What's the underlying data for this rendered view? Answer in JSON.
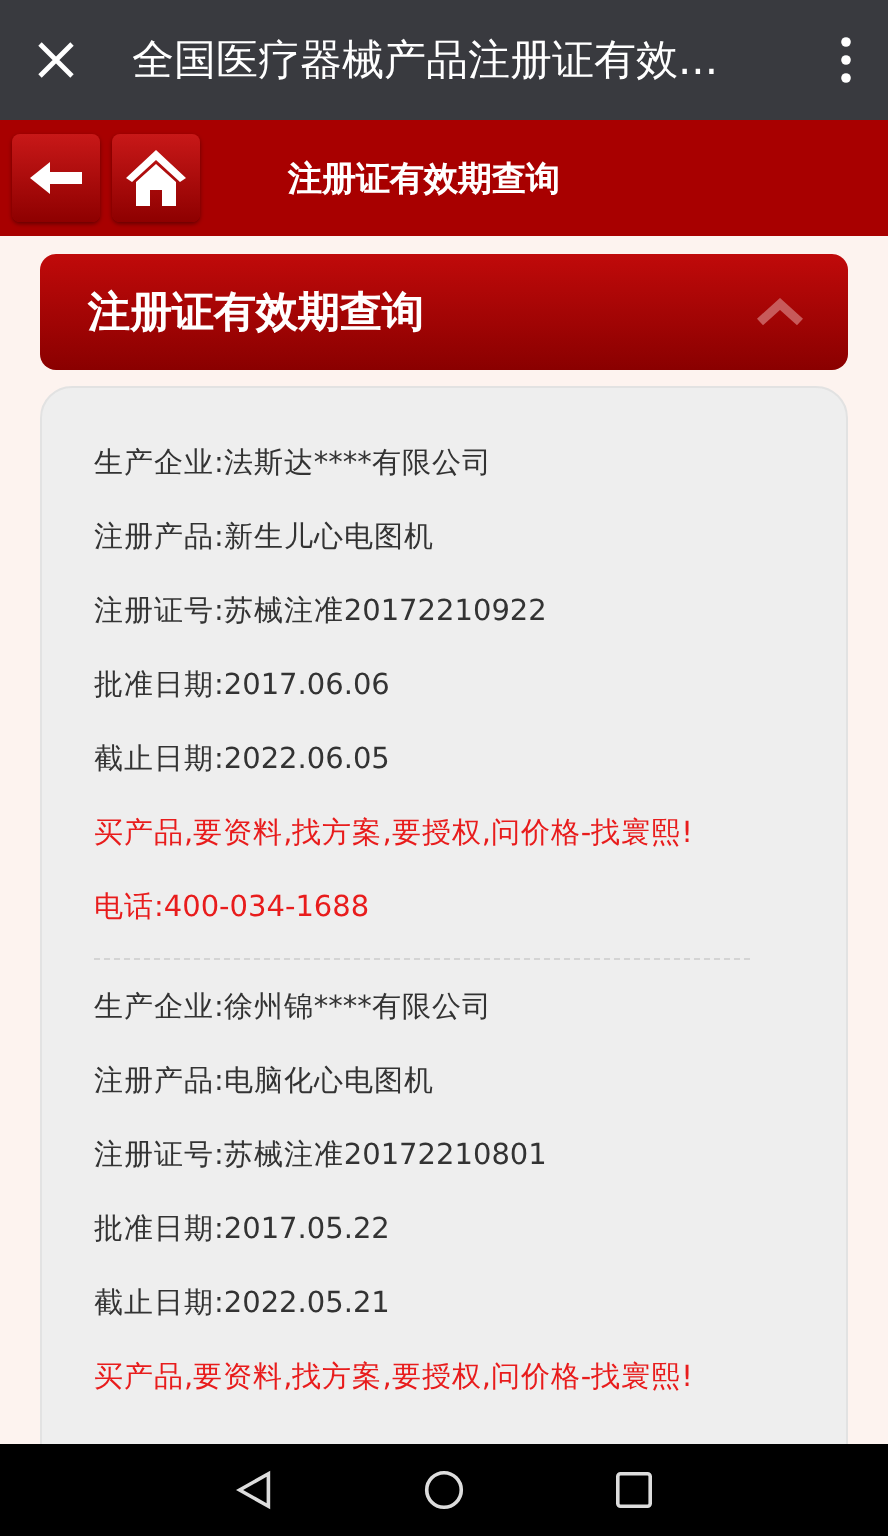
{
  "window": {
    "title": "全国医疗器械产品注册证有效..."
  },
  "header": {
    "title": "注册证有效期查询"
  },
  "section": {
    "title": "注册证有效期查询",
    "expanded": true
  },
  "records": [
    {
      "lines": [
        {
          "kind": "info",
          "text": "生产企业:法斯达****有限公司"
        },
        {
          "kind": "info",
          "text": "注册产品:新生儿心电图机"
        },
        {
          "kind": "info",
          "text": "注册证号:苏械注准20172210922"
        },
        {
          "kind": "info",
          "text": "批准日期:2017.06.06"
        },
        {
          "kind": "info",
          "text": "截止日期:2022.06.05"
        },
        {
          "kind": "promo",
          "text": "买产品,要资料,找方案,要授权,问价格-找寰熙!"
        },
        {
          "kind": "promo",
          "text": "电话:400-034-1688"
        }
      ]
    },
    {
      "lines": [
        {
          "kind": "info",
          "text": "生产企业:徐州锦****有限公司"
        },
        {
          "kind": "info",
          "text": "注册产品:电脑化心电图机"
        },
        {
          "kind": "info",
          "text": "注册证号:苏械注准20172210801"
        },
        {
          "kind": "info",
          "text": "批准日期:2017.05.22"
        },
        {
          "kind": "info",
          "text": "截止日期:2022.05.21"
        },
        {
          "kind": "promo",
          "text": "买产品,要资料,找方案,要授权,问价格-找寰熙!"
        }
      ]
    }
  ]
}
